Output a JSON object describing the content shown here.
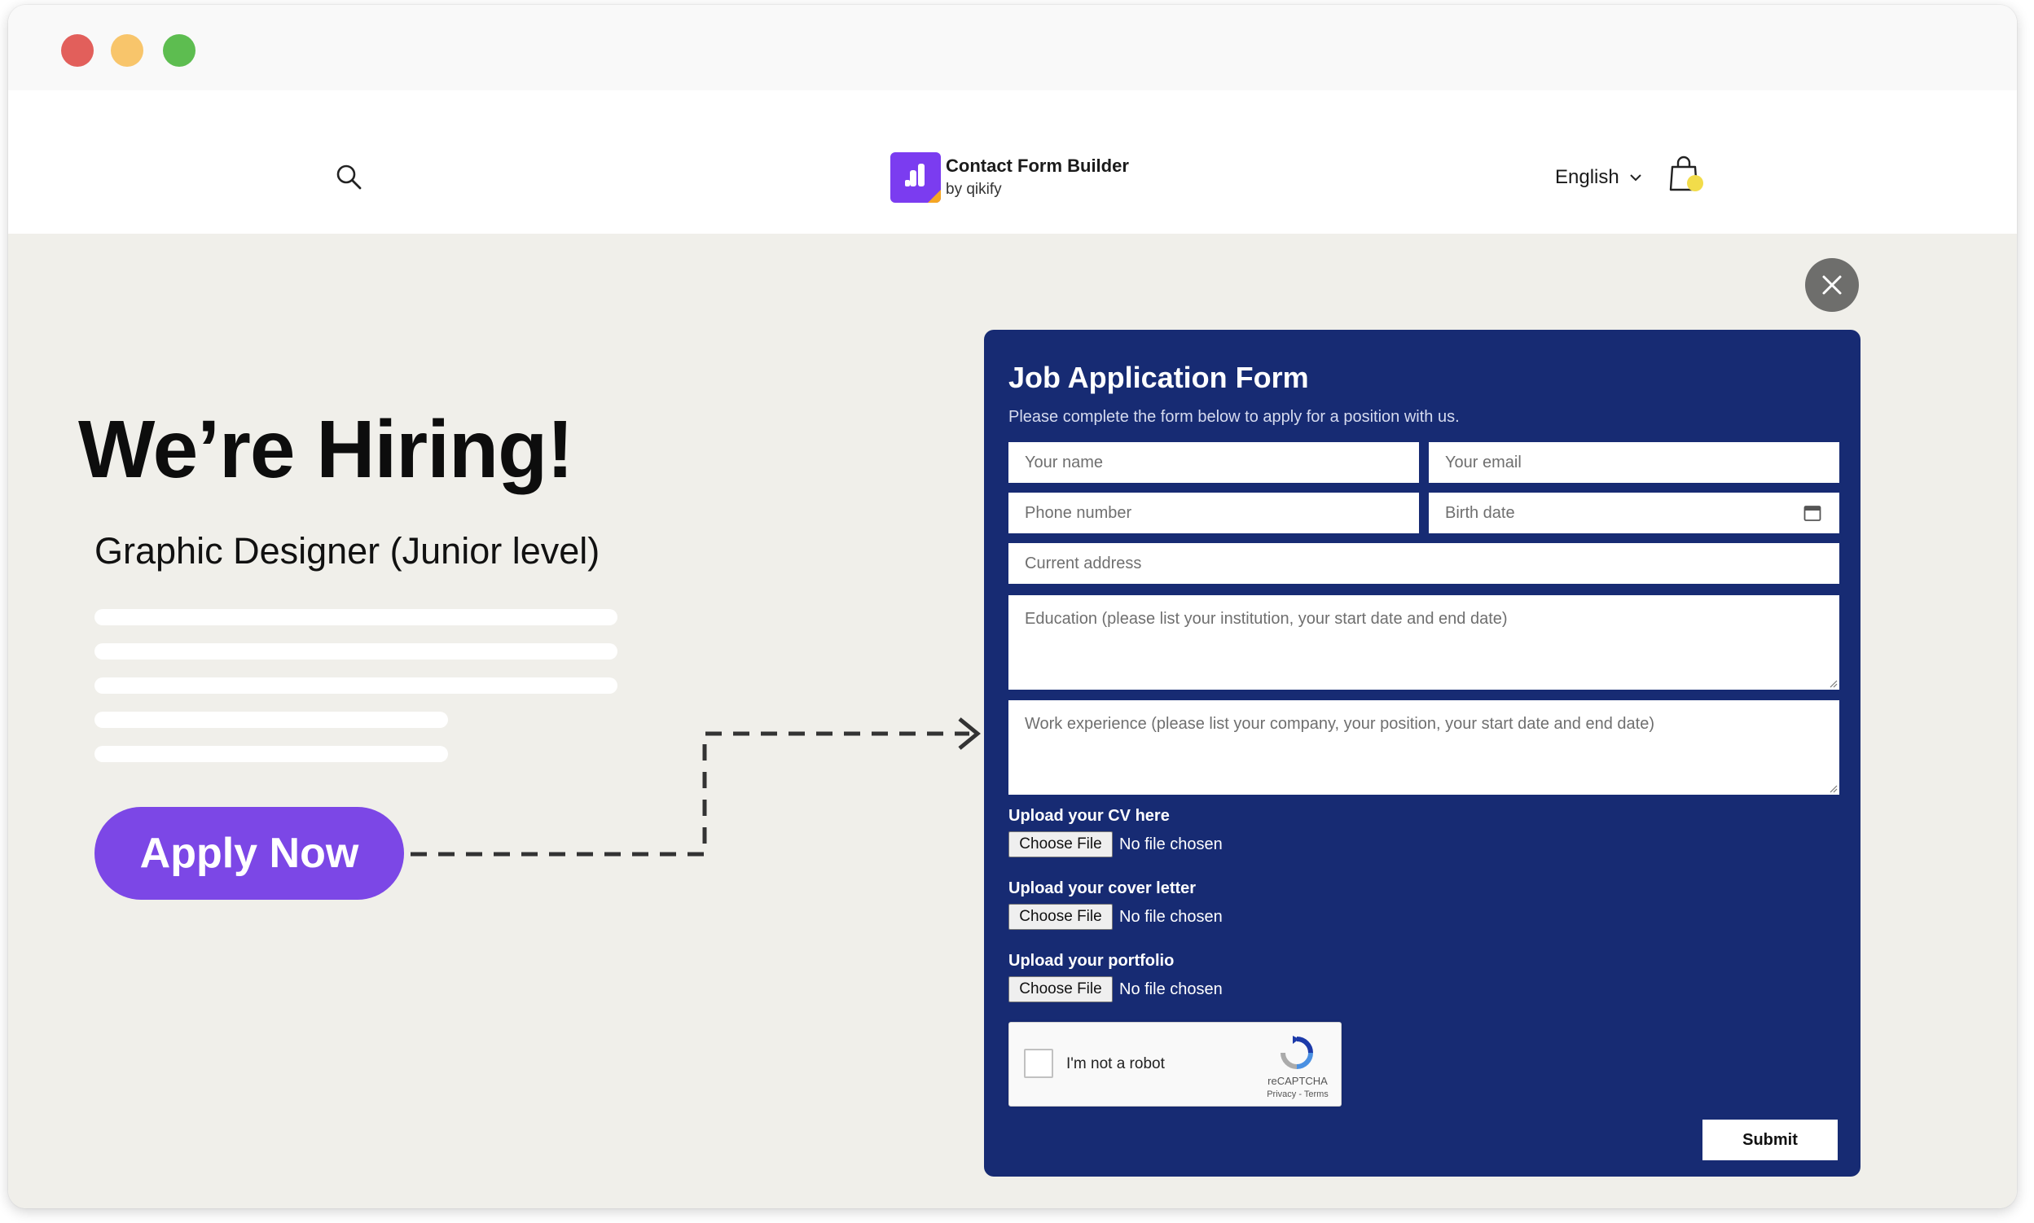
{
  "header": {
    "logo_title": "Contact Form Builder",
    "logo_sub": "by qikify",
    "language": "English"
  },
  "hero": {
    "headline": "We’re Hiring!",
    "position": "Graphic Designer (Junior level)",
    "apply_label": "Apply Now"
  },
  "form": {
    "title": "Job Application Form",
    "description": "Please complete the form below to apply for a position with us.",
    "fields": {
      "name": "Your name",
      "email": "Your email",
      "phone": "Phone number",
      "birth": "Birth date",
      "address": "Current address",
      "education": "Education (please list your institution, your start date and end date)",
      "experience": "Work experience (please list your company, your position, your start date and end date)"
    },
    "uploads": [
      {
        "label": "Upload your CV here",
        "button": "Choose File",
        "status": "No file chosen"
      },
      {
        "label": "Upload your cover letter",
        "button": "Choose File",
        "status": "No file chosen"
      },
      {
        "label": "Upload your portfolio",
        "button": "Choose File",
        "status": "No file chosen"
      }
    ],
    "captcha": {
      "label": "I'm not a robot",
      "brand": "reCAPTCHA",
      "links": "Privacy - Terms"
    },
    "submit_label": "Submit"
  },
  "colors": {
    "form_bg": "#172b73",
    "hero_bg": "#f0efea",
    "apply_button": "#7c47e6",
    "logo": "#7b3cf0"
  },
  "icons": [
    "search-icon",
    "chevron-down-icon",
    "shopping-bag-icon",
    "close-icon",
    "calendar-icon",
    "recaptcha-icon"
  ]
}
